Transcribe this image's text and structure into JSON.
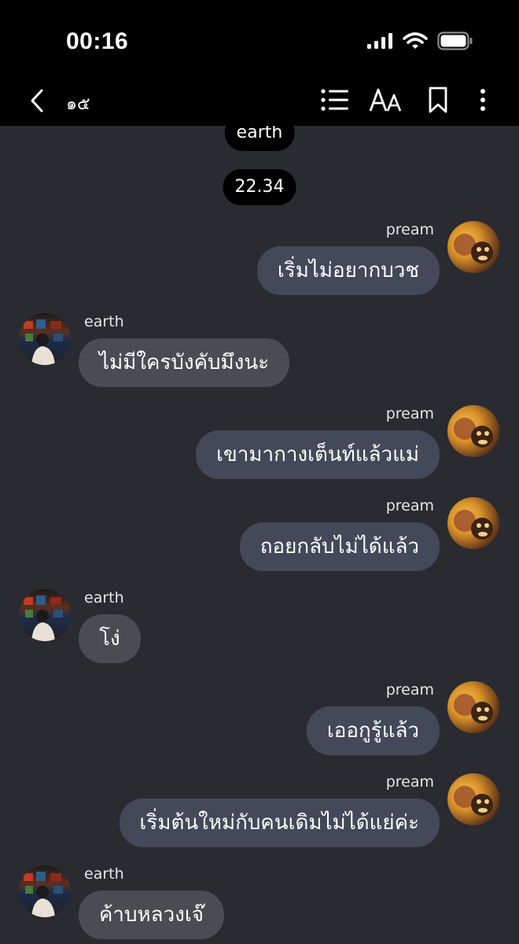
{
  "status": {
    "time": "00:16"
  },
  "nav": {
    "title": "๑๕"
  },
  "senders": {
    "earth": "earth",
    "pream": "pream"
  },
  "pills": {
    "top_name": "earth",
    "timestamp": "22.34"
  },
  "messages": [
    {
      "sender": "pream",
      "text": "เริ่มไม่อยากบวช"
    },
    {
      "sender": "earth",
      "text": "ไม่มีใครบังคับมึงนะ"
    },
    {
      "sender": "pream",
      "text": "เขามากางเต็นท์แล้วแม่"
    },
    {
      "sender": "pream",
      "text": "ถอยกลับไม่ได้แล้ว"
    },
    {
      "sender": "earth",
      "text": "โง่"
    },
    {
      "sender": "pream",
      "text": "เออกูรู้แล้ว"
    },
    {
      "sender": "pream",
      "text": "เริ่มต้นใหม่กับคนเดิมไม่ได้แย่ค่ะ"
    },
    {
      "sender": "earth",
      "text": "ค้าบหลวงเจ๊"
    }
  ]
}
